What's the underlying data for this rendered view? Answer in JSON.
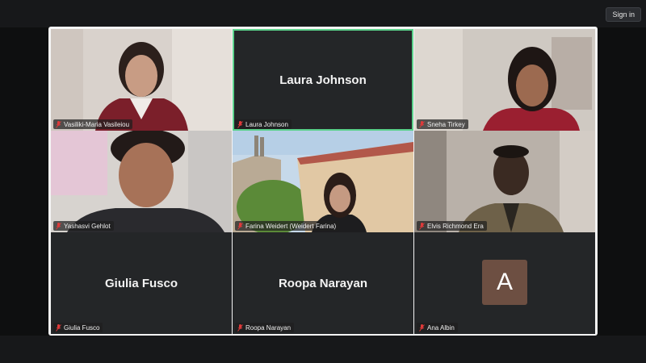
{
  "header": {
    "signin_label": "Sign in"
  },
  "tiles": [
    {
      "name": "Vasiliki-Maria Vasileiou",
      "video": true
    },
    {
      "name": "Laura Johnson",
      "video": false,
      "active": true
    },
    {
      "name": "Sneha Tirkey",
      "video": true
    },
    {
      "name": "Yashasvi Gehlot",
      "video": true
    },
    {
      "name": "Farina Weidert (Weidert Farina)",
      "video": true
    },
    {
      "name": "Elvis Richmond Era",
      "video": true
    },
    {
      "name": "Giulia Fusco",
      "video": false
    },
    {
      "name": "Roopa Narayan",
      "video": false
    },
    {
      "name": "Ana Albin",
      "video": false,
      "avatar_letter": "A"
    }
  ],
  "colors": {
    "speaker_border": "#5ad18a",
    "muted_icon": "#e03a3a",
    "avatar_bg": "#6d4f42"
  }
}
